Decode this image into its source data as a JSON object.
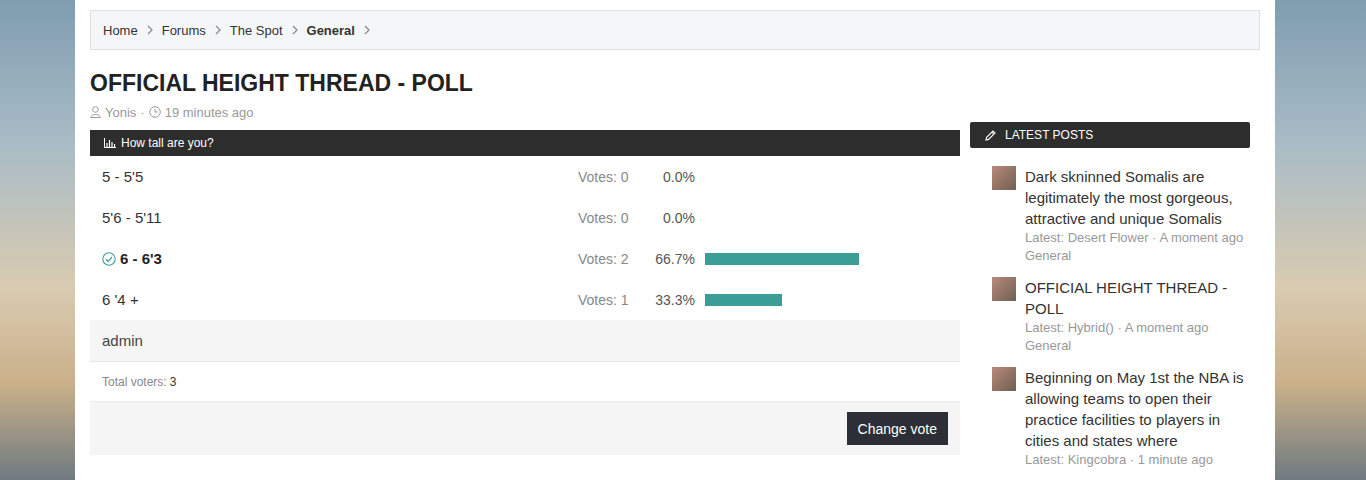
{
  "breadcrumbs": [
    {
      "label": "Home",
      "current": false
    },
    {
      "label": "Forums",
      "current": false
    },
    {
      "label": "The Spot",
      "current": false
    },
    {
      "label": "General",
      "current": true
    }
  ],
  "thread": {
    "title": "OFFICIAL HEIGHT THREAD - POLL",
    "author": "Yonis",
    "separator": "·",
    "time": "19 minutes ago"
  },
  "poll": {
    "question": "How tall are you?",
    "options": [
      {
        "label": "5 - 5'5",
        "votes": "Votes: 0",
        "percent": "0.0%",
        "level": 0,
        "selected": false
      },
      {
        "label": "5'6 - 5'11",
        "votes": "Votes: 0",
        "percent": "0.0%",
        "level": 0,
        "selected": false
      },
      {
        "label": "6 - 6'3",
        "votes": "Votes: 2",
        "percent": "66.7%",
        "level": 0.667,
        "selected": true
      },
      {
        "label": "6 '4 +",
        "votes": "Votes: 1",
        "percent": "33.3%",
        "level": 0.333,
        "selected": false
      }
    ],
    "voter_name": "admin",
    "total_label": "Total voters:",
    "total_value": "3",
    "button": "Change vote"
  },
  "sidebar": {
    "title": "LATEST POSTS",
    "posts": [
      {
        "title": "Dark skninned Somalis are legitimately the most gorgeous, attractive and unique Somalis",
        "meta": "Latest: Desert Flower · A moment ago",
        "forum": "General"
      },
      {
        "title": "OFFICIAL HEIGHT THREAD - POLL",
        "meta": "Latest: Hybrid() · A moment ago",
        "forum": "General"
      },
      {
        "title": "Beginning on May 1st the NBA is allowing teams to open their practice facilities to players in cities and states where",
        "meta": "Latest: Kingcobra · 1 minute ago",
        "forum": ""
      }
    ]
  }
}
